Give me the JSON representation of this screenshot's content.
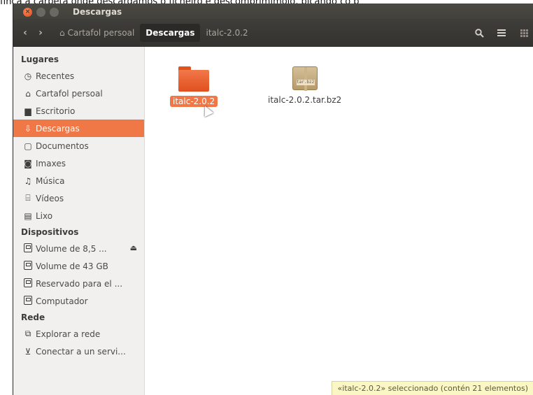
{
  "caption": {
    "text": "finca a carpeta onde descargamos o ficheiro e descomprimímolo, picando co b"
  },
  "window": {
    "title": "Descargas"
  },
  "toolbar": {
    "back_icon": "chevron-left-icon",
    "forward_icon": "chevron-right-icon",
    "breadcrumbs": [
      "Cartafol persoal",
      "Descargas",
      "italc-2.0.2"
    ],
    "search_icon": "search-icon",
    "list_icon": "list-icon",
    "grid_icon": "grid-icon"
  },
  "sidebar": {
    "places_title": "Lugares",
    "places": [
      {
        "label": "Recentes",
        "icon": "clock-icon"
      },
      {
        "label": "Cartafol persoal",
        "icon": "home-icon"
      },
      {
        "label": "Escritorio",
        "icon": "desktop-icon"
      },
      {
        "label": "Descargas",
        "icon": "download-icon"
      },
      {
        "label": "Documentos",
        "icon": "document-icon"
      },
      {
        "label": "Imaxes",
        "icon": "camera-icon"
      },
      {
        "label": "Música",
        "icon": "music-icon"
      },
      {
        "label": "Vídeos",
        "icon": "film-icon"
      },
      {
        "label": "Lixo",
        "icon": "trash-icon"
      }
    ],
    "devices_title": "Dispositivos",
    "devices": [
      {
        "label": "Volume de 8,5 ...",
        "icon": "drive-icon"
      },
      {
        "label": "Volume de 43 GB",
        "icon": "drive-icon"
      },
      {
        "label": "Reservado para el ...",
        "icon": "drive-icon"
      },
      {
        "label": "Computador",
        "icon": "drive-icon"
      }
    ],
    "network_title": "Rede",
    "network": [
      {
        "label": "Explorar a rede",
        "icon": "network-icon"
      },
      {
        "label": "Conectar a un servi...",
        "icon": "server-icon"
      }
    ]
  },
  "content": {
    "files": [
      {
        "name": "italc-2.0.2",
        "type": "folder",
        "selected": true
      },
      {
        "name": "italc-2.0.2.tar.bz2",
        "type": "archive",
        "selected": false,
        "badge": "tar.bz2"
      }
    ]
  },
  "status": {
    "text": "«italc-2.0.2» seleccionado  (contén 21 elementos)"
  },
  "colors": {
    "accent": "#f07746",
    "titlebar": "#3c3b37",
    "sidebar_bg": "#f1f0ee",
    "status_bg": "#fbf7c5"
  }
}
